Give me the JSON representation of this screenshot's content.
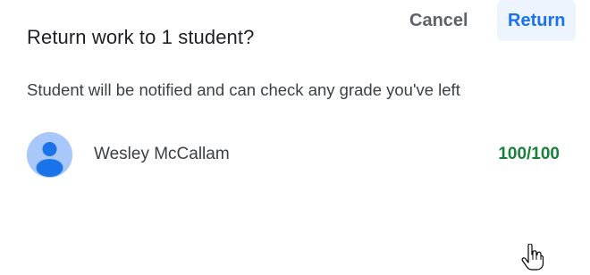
{
  "dialog": {
    "title": "Return work to 1 student?",
    "message": "Student will be notified and can check any grade you've left",
    "student": {
      "avatar_icon": "account-circle-icon",
      "name": "Wesley McCallam",
      "grade": "100/100"
    },
    "buttons": {
      "cancel_label": "Cancel",
      "return_label": "Return"
    }
  },
  "colors": {
    "grade": "#188038",
    "primary": "#1a73e8",
    "avatar_bg": "#a8c7fa",
    "avatar_fg": "#1a73e8"
  },
  "cursor_icon": "hand-pointer-icon"
}
